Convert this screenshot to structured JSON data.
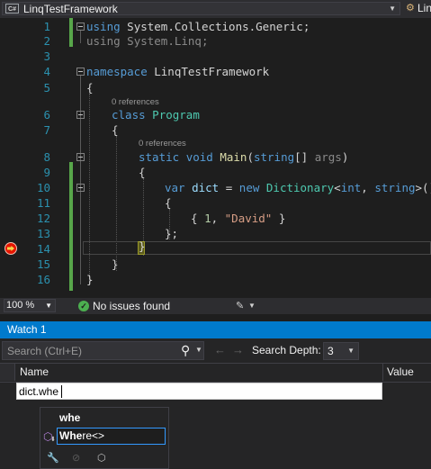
{
  "navbar": {
    "project_icon": "C#",
    "project_name": "LinqTestFramework",
    "right_icon_name": "class-icon",
    "right_text": "Lin"
  },
  "editor": {
    "line_numbers": [
      "1",
      "2",
      "3",
      "4",
      "5",
      "6",
      "7",
      "8",
      "9",
      "10",
      "11",
      "12",
      "13",
      "14",
      "15",
      "16"
    ],
    "lines": {
      "l1_kw": "using",
      "l1_rest": " System.Collections.Generic;",
      "l2_kw": "using",
      "l2_rest": " System.Linq;",
      "l4_kw": "namespace",
      "l4_rest": " LinqTestFramework",
      "l5": "{",
      "l6_kw": "class",
      "l6_type": "Program",
      "l7": "{",
      "l8_kw1": "static",
      "l8_kw2": "void",
      "l8_method": "Main",
      "l8_open": "(",
      "l8_kw3": "string",
      "l8_br": "[]",
      "l8_param": "args",
      "l8_close": ")",
      "l9": "{",
      "l10_kw": "var",
      "l10_var": "dict",
      "l10_eq": " = ",
      "l10_new": "new",
      "l10_type": "Dictionary",
      "l10_lt": "<",
      "l10_t1": "int",
      "l10_comma": ", ",
      "l10_t2": "string",
      "l10_end": ">()",
      "l11": "{",
      "l12_open": "{ ",
      "l12_num": "1",
      "l12_comma": ", ",
      "l12_str": "\"David\"",
      "l12_close": " }",
      "l13": "};",
      "l14": "}",
      "l15": "}",
      "l16": "}"
    },
    "references_class": "0 references",
    "references_method": "0 references"
  },
  "status": {
    "zoom": "100 %",
    "issues": "No issues found"
  },
  "watch": {
    "title": "Watch 1",
    "search_placeholder": "Search (Ctrl+E)",
    "search_depth_label": "Search Depth:",
    "search_depth_value": "3",
    "col_name": "Name",
    "col_value": "Value",
    "edit_text": "dict.whe"
  },
  "intellisense": {
    "header": "whe",
    "item_match": "Whe",
    "item_rest": "re<>",
    "item_icon": "extension-method-icon"
  },
  "colors": {
    "accent": "#007acc",
    "keyword": "#569cd6",
    "type": "#4ec9b0",
    "string": "#d69d85",
    "change_bar": "#57a64a",
    "breakpoint": "#e51400"
  }
}
